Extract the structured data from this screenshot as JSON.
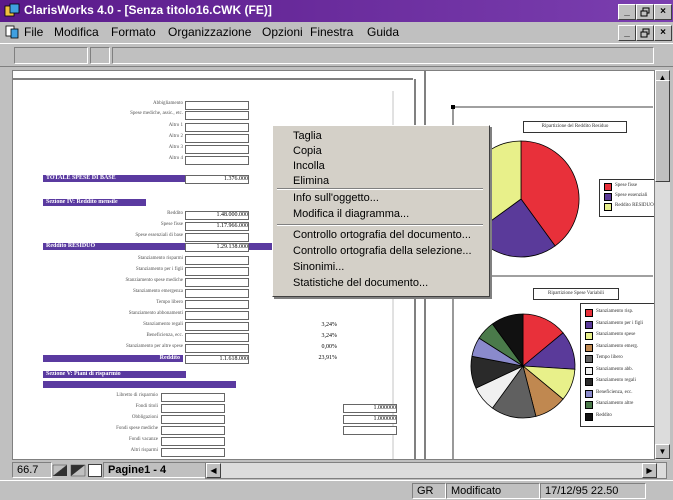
{
  "window": {
    "title": "ClarisWorks 4.0 - [Senza titolo16.CWK (FE)]",
    "buttons": {
      "minimize": "_",
      "restore": "̱",
      "close": "×"
    }
  },
  "menubar": {
    "items": [
      {
        "label": "File"
      },
      {
        "label": "Modifica"
      },
      {
        "label": "Formato"
      },
      {
        "label": "Organizzazione"
      },
      {
        "label": "Opzioni"
      },
      {
        "label": "Finestra"
      },
      {
        "label": "Guida"
      }
    ]
  },
  "context_menu": {
    "groups": [
      [
        "Taglia",
        "Copia",
        "Incolla",
        "Elimina"
      ],
      [
        "Info sull'oggetto...",
        "Modifica il diagramma..."
      ],
      [
        "Controllo ortografia del documento...",
        "Controllo ortografia della selezione...",
        "Sinonimi...",
        "Statistiche del documento..."
      ]
    ]
  },
  "spreadsheet": {
    "bands": [
      "TOTALE SPESE DI BASE",
      "Reddito RESIDUO",
      "Reddito"
    ],
    "total_value": "1.376.000",
    "values": [
      "1.48.000.000",
      "1.17.966.000",
      "1.29.138.000",
      "1.1.618.000"
    ],
    "percentages": [
      "3,24%",
      "3,24%",
      "0,00%",
      "23,91%"
    ],
    "right_values": [
      "1.000000",
      "1.000000"
    ]
  },
  "charts": {
    "chart1_title": "Ripartizione del Reddito Residuo",
    "chart2_title": "Ripartizione Spese Variabili"
  },
  "chart_data": [
    {
      "type": "pie",
      "colors": [
        "#e8303a",
        "#5a3a9a",
        "#e8f08a"
      ],
      "values": [
        40,
        25,
        35
      ]
    },
    {
      "type": "pie",
      "colors": [
        "#e8303a",
        "#5a3a9a",
        "#e8f08a",
        "#c08850",
        "#606060",
        "#f0f0f0",
        "#2a2a2a",
        "#8a8acc",
        "#4a7a4a",
        "#111111"
      ],
      "values": [
        14,
        12,
        10,
        10,
        14,
        8,
        10,
        6,
        6,
        10
      ]
    }
  ],
  "bottom": {
    "zoom": "66.7",
    "page_label": "Pagine1 - 4"
  },
  "statusbar": {
    "caps": "GR",
    "state": "Modificato",
    "datetime": "17/12/95 22.50"
  }
}
